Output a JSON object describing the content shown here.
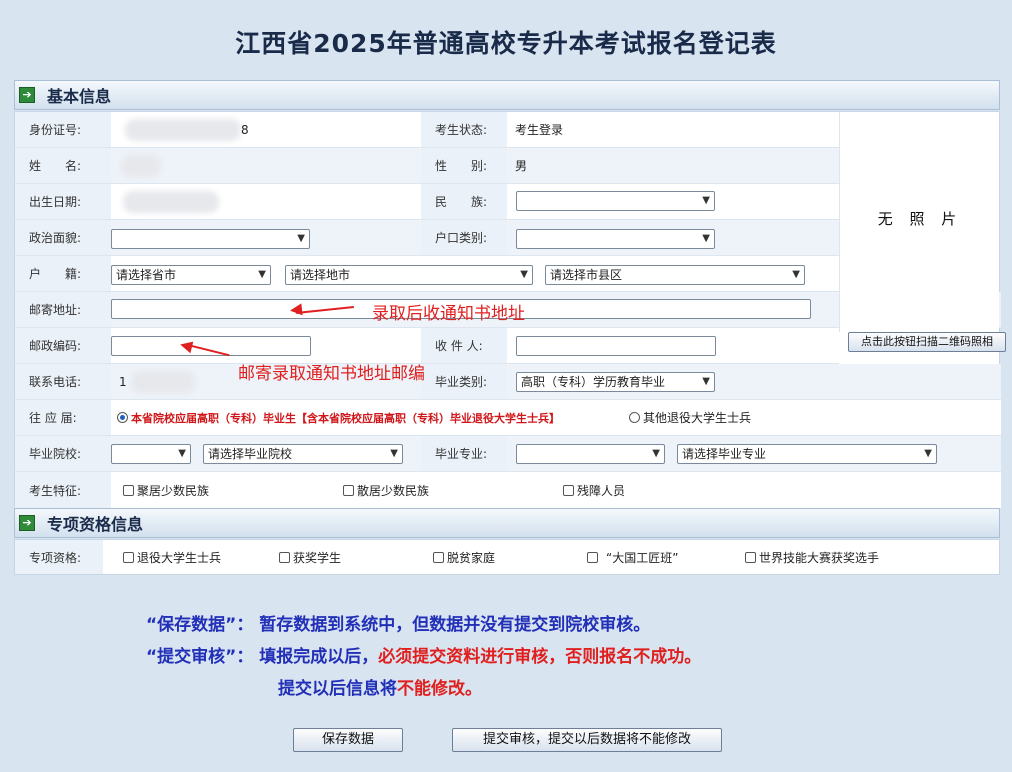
{
  "title": "江西省2025年普通高校专升本考试报名登记表",
  "section_basic": "基本信息",
  "section_special": "专项资格信息",
  "fields": {
    "id_label": "身份证号:",
    "id_value_tail": "8",
    "status_label": "考生状态:",
    "status_value": "考生登录",
    "name_label": "姓　　名:",
    "gender_label": "性　　别:",
    "gender_value": "男",
    "birth_label": "出生日期:",
    "ethnic_label": "民　　族:",
    "politics_label": "政治面貌:",
    "hukou_type_label": "户口类别:",
    "huji_label": "户　　籍:",
    "province_select": "请选择省市",
    "city_select": "请选择地市",
    "county_select": "请选择市县区",
    "mail_addr_label": "邮寄地址:",
    "postcode_label": "邮政编码:",
    "receiver_label": "收 件 人:",
    "phone_label": "联系电话:",
    "phone_value_head": "1",
    "grad_type_label": "毕业类别:",
    "grad_type_value": "高职（专科）学历教育毕业",
    "cohort_label": "往 应 届:",
    "cohort_opt1": "本省院校应届高职（专科）毕业生【含本省院校应届高职（专科）毕业退役大学生士兵】",
    "cohort_opt2": "其他退役大学生士兵",
    "grad_school_label": "毕业院校:",
    "grad_school_select": "请选择毕业院校",
    "grad_major_label": "毕业专业:",
    "grad_major_select": "请选择毕业专业",
    "feature_label": "考生特征:",
    "feature_opts": [
      "聚居少数民族",
      "散居少数民族",
      "残障人员"
    ],
    "special_label": "专项资格:",
    "special_opts": [
      "退役大学生士兵",
      "获奖学生",
      "脱贫家庭",
      "“大国工匠班”",
      "世界技能大赛获奖选手"
    ]
  },
  "photo": {
    "text": "无 照 片",
    "scan_button": "点击此按钮扫描二维码照相"
  },
  "annotations": {
    "addr_hint": "录取后收通知书地址",
    "postcode_hint": "邮寄录取通知书地址邮编"
  },
  "notes": {
    "save_title": "“保存数据”：",
    "save_text": "暂存数据到系统中，但数据并没有提交到院校审核。",
    "submit_title": "“提交审核”：",
    "submit_text1": "填报完成以后，",
    "submit_text2": "必须提交资料进行审核，否则报名不成功。",
    "submit_line3a": "提交以后信息将",
    "submit_line3b": "不能修改。"
  },
  "buttons": {
    "save": "保存数据",
    "submit": "提交审核，提交以后数据将不能修改"
  },
  "colors": {
    "accent_blue": "#2230b8",
    "warning_red": "#e0201f",
    "section_icon_green": "#2e8b3a"
  }
}
